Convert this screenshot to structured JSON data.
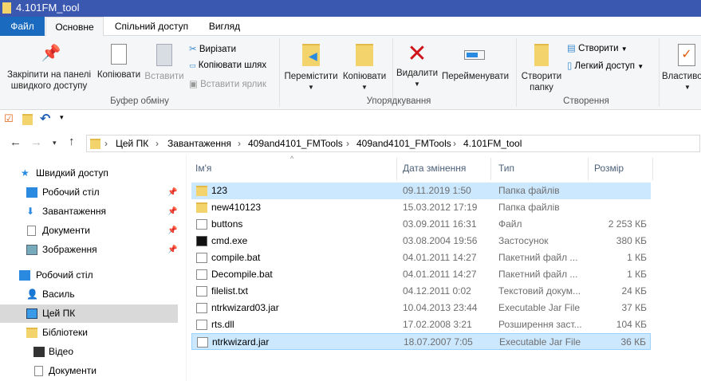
{
  "window": {
    "title": "4.101FM_tool"
  },
  "tabs": [
    "Файл",
    "Основне",
    "Спільний доступ",
    "Вигляд"
  ],
  "ribbon": {
    "clipboard": {
      "pin": "Закріпити на панелі",
      "pin2": "швидкого доступу",
      "copy": "Копіювати",
      "paste": "Вставити",
      "cut": "Вирізати",
      "copy_path": "Копіювати шлях",
      "paste_shortcut": "Вставити ярлик",
      "group": "Буфер обміну"
    },
    "organize": {
      "move": "Перемістити",
      "copy": "Копіювати",
      "delete": "Видалити",
      "rename": "Перейменувати",
      "group": "Упорядкування"
    },
    "new": {
      "new_folder": "Створити",
      "new_folder2": "папку",
      "new_item": "Створити",
      "easy_access": "Легкий доступ",
      "group": "Створення"
    },
    "open": {
      "properties": "Властивості"
    }
  },
  "address": {
    "crumbs": [
      "Цей ПК",
      "Завантаження",
      "409and4101_FMTools",
      "409and4101_FMTools",
      "4.101FM_tool"
    ]
  },
  "nav": {
    "items": [
      {
        "label": "Швидкий доступ"
      },
      {
        "label": "Робочий стіл"
      },
      {
        "label": "Завантаження"
      },
      {
        "label": "Документи"
      },
      {
        "label": "Зображення"
      },
      {
        "label": "Робочий стіл"
      },
      {
        "label": "Василь"
      },
      {
        "label": "Цей ПК"
      },
      {
        "label": "Бібліотеки"
      },
      {
        "label": "Відео"
      },
      {
        "label": "Документи"
      }
    ]
  },
  "columns": {
    "name": "Ім'я",
    "date": "Дата змінення",
    "type": "Тип",
    "size": "Розмір"
  },
  "files": [
    {
      "name": "123",
      "date": "09.11.2019 1:50",
      "type": "Папка файлів",
      "size": ""
    },
    {
      "name": "new410123",
      "date": "15.03.2012 17:19",
      "type": "Папка файлів",
      "size": ""
    },
    {
      "name": "buttons",
      "date": "03.09.2011 16:31",
      "type": "Файл",
      "size": "2 253 КБ"
    },
    {
      "name": "cmd.exe",
      "date": "03.08.2004 19:56",
      "type": "Застосунок",
      "size": "380 КБ"
    },
    {
      "name": "compile.bat",
      "date": "04.01.2011 14:27",
      "type": "Пакетний файл ...",
      "size": "1 КБ"
    },
    {
      "name": "Decompile.bat",
      "date": "04.01.2011 14:27",
      "type": "Пакетний файл ...",
      "size": "1 КБ"
    },
    {
      "name": "filelist.txt",
      "date": "04.12.2011 0:02",
      "type": "Текстовий докум...",
      "size": "24 КБ"
    },
    {
      "name": "ntrkwizard03.jar",
      "date": "10.04.2013 23:44",
      "type": "Executable Jar File",
      "size": "37 КБ"
    },
    {
      "name": "rts.dll",
      "date": "17.02.2008 3:21",
      "type": "Розширення заст...",
      "size": "104 КБ"
    },
    {
      "name": "ntrkwizard.jar",
      "date": "18.07.2007 7:05",
      "type": "Executable Jar File",
      "size": "36 КБ"
    }
  ]
}
